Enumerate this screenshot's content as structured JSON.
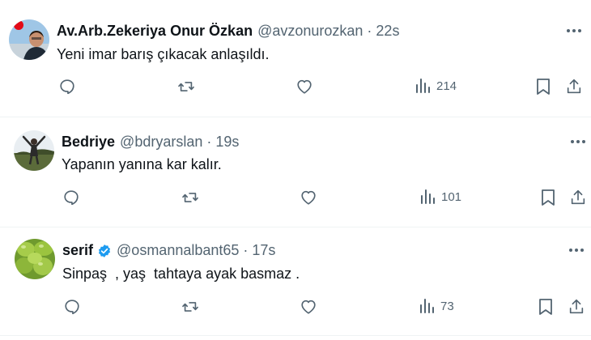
{
  "tweets": [
    {
      "name": "Av.Arb.Zekeriya Onur Özkan",
      "handle": "@avzonurozkan",
      "dot": "·",
      "time": "22s",
      "text": "Yeni imar barış çıkacak anlaşıldı.",
      "views": "214",
      "verified": false
    },
    {
      "name": "Bedriye",
      "handle": "@bdryarslan",
      "dot": "·",
      "time": "19s",
      "text": "Yapanın yanına kar kalır.",
      "views": "101",
      "verified": false
    },
    {
      "name": "serif",
      "handle": "@osmannalbant65",
      "dot": "·",
      "time": "17s",
      "text": "Sinpaş  , yaş  tahtaya ayak basmaz .",
      "views": "73",
      "verified": true
    }
  ],
  "colors": {
    "text_primary": "#0f1419",
    "text_secondary": "#536471",
    "verified_blue": "#1d9bf0",
    "divider": "#eff3f4"
  },
  "icons": [
    "reply-icon",
    "retweet-icon",
    "like-icon",
    "views-icon",
    "bookmark-icon",
    "share-icon",
    "more-icon",
    "verified-badge-icon"
  ]
}
